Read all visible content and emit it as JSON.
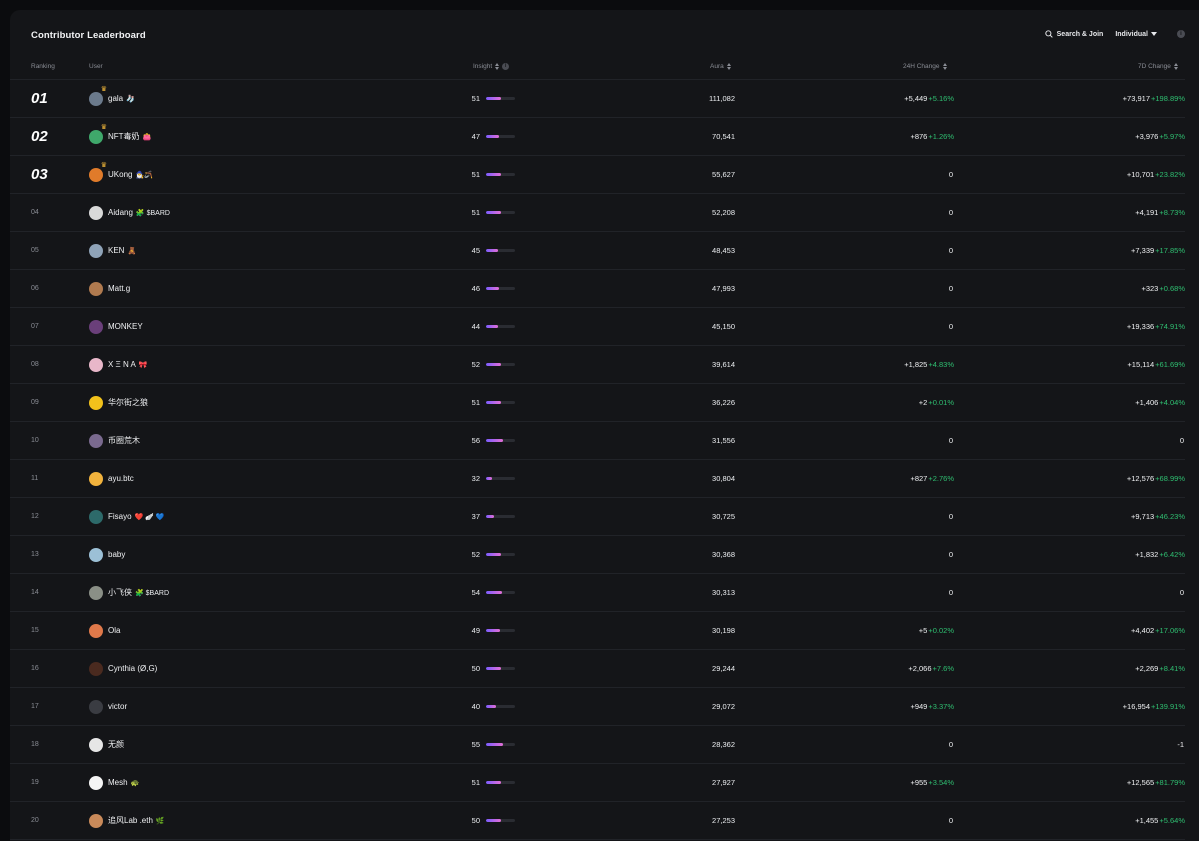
{
  "header": {
    "title": "Contributor Leaderboard",
    "search_join": "Search & Join",
    "filter_selected": "Individual",
    "info_icon": "info-icon"
  },
  "columns": {
    "ranking": "Ranking",
    "user": "User",
    "insight": "Insight",
    "aura": "Aura",
    "change_24h": "24H Change",
    "change_7d": "7D Change"
  },
  "colors": {
    "background": "#141518",
    "positive": "#2fbf71",
    "bar_start": "#7b5cff",
    "bar_end": "#e36fd6"
  },
  "rows": [
    {
      "rank": "01",
      "name": "gala",
      "emoji": "🧦",
      "insight": "51",
      "aura": "111,082",
      "d24": "+5,449",
      "p24": "+5.16%",
      "d7": "+73,917",
      "p7": "+198.89%",
      "avatar": "#6b7a8c",
      "crown": true
    },
    {
      "rank": "02",
      "name": "NFT毒奶",
      "emoji": "👛",
      "insight": "47",
      "aura": "70,541",
      "d24": "+876",
      "p24": "+1.26%",
      "d7": "+3,976",
      "p7": "+5.97%",
      "avatar": "#3fa86b",
      "crown": true
    },
    {
      "rank": "03",
      "name": "UKong",
      "emoji": "🧙‍♂️🪃",
      "insight": "51",
      "aura": "55,627",
      "d24": "0",
      "p24": "",
      "d7": "+10,701",
      "p7": "+23.82%",
      "avatar": "#e07b2a",
      "crown": true
    },
    {
      "rank": "04",
      "name": "Aidang",
      "emoji": "🧩 $BARD",
      "insight": "51",
      "aura": "52,208",
      "d24": "0",
      "p24": "",
      "d7": "+4,191",
      "p7": "+8.73%",
      "avatar": "#d9d9d9",
      "crown": false
    },
    {
      "rank": "05",
      "name": "KEN",
      "emoji": "🧸",
      "insight": "45",
      "aura": "48,453",
      "d24": "0",
      "p24": "",
      "d7": "+7,339",
      "p7": "+17.85%",
      "avatar": "#8fa3b8",
      "crown": false
    },
    {
      "rank": "06",
      "name": "Matt.g",
      "emoji": "",
      "insight": "46",
      "aura": "47,993",
      "d24": "0",
      "p24": "",
      "d7": "+323",
      "p7": "+0.68%",
      "avatar": "#b07a4f",
      "crown": false
    },
    {
      "rank": "07",
      "name": "MONKEY",
      "emoji": "",
      "insight": "44",
      "aura": "45,150",
      "d24": "0",
      "p24": "",
      "d7": "+19,336",
      "p7": "+74.91%",
      "avatar": "#6a3f7a",
      "crown": false
    },
    {
      "rank": "08",
      "name": "X Ξ N A",
      "emoji": "🎀",
      "insight": "52",
      "aura": "39,614",
      "d24": "+1,825",
      "p24": "+4.83%",
      "d7": "+15,114",
      "p7": "+61.69%",
      "avatar": "#e8b7c9",
      "crown": false
    },
    {
      "rank": "09",
      "name": "华尔街之狼",
      "emoji": "",
      "insight": "51",
      "aura": "36,226",
      "d24": "+2",
      "p24": "+0.01%",
      "d7": "+1,406",
      "p7": "+4.04%",
      "avatar": "#f2c21b",
      "crown": false
    },
    {
      "rank": "10",
      "name": "币圈荒木",
      "emoji": "",
      "insight": "56",
      "aura": "31,556",
      "d24": "0",
      "p24": "",
      "d7": "0",
      "p7": "",
      "avatar": "#7a6a8f",
      "crown": false
    },
    {
      "rank": "11",
      "name": "ayu.btc",
      "emoji": "",
      "insight": "32",
      "aura": "30,804",
      "d24": "+827",
      "p24": "+2.76%",
      "d7": "+12,576",
      "p7": "+68.99%",
      "avatar": "#f2b33d",
      "crown": false
    },
    {
      "rank": "12",
      "name": "Fisayo",
      "emoji": "❤️ 🪽 💙",
      "insight": "37",
      "aura": "30,725",
      "d24": "0",
      "p24": "",
      "d7": "+9,713",
      "p7": "+46.23%",
      "avatar": "#2d6a6a",
      "crown": false
    },
    {
      "rank": "13",
      "name": "baby",
      "emoji": "",
      "insight": "52",
      "aura": "30,368",
      "d24": "0",
      "p24": "",
      "d7": "+1,832",
      "p7": "+6.42%",
      "avatar": "#9cc0d6",
      "crown": false
    },
    {
      "rank": "14",
      "name": "小飞侠",
      "emoji": "🧩 $BARD",
      "insight": "54",
      "aura": "30,313",
      "d24": "0",
      "p24": "",
      "d7": "0",
      "p7": "",
      "avatar": "#8a8f86",
      "crown": false
    },
    {
      "rank": "15",
      "name": "Ola",
      "emoji": "",
      "insight": "49",
      "aura": "30,198",
      "d24": "+5",
      "p24": "+0.02%",
      "d7": "+4,402",
      "p7": "+17.06%",
      "avatar": "#e0794a",
      "crown": false
    },
    {
      "rank": "16",
      "name": "Cynthia (Ø,G)",
      "emoji": "",
      "insight": "50",
      "aura": "29,244",
      "d24": "+2,066",
      "p24": "+7.6%",
      "d7": "+2,269",
      "p7": "+8.41%",
      "avatar": "#4a2a1f",
      "crown": false
    },
    {
      "rank": "17",
      "name": "victor",
      "emoji": "",
      "insight": "40",
      "aura": "29,072",
      "d24": "+949",
      "p24": "+3.37%",
      "d7": "+16,954",
      "p7": "+139.91%",
      "avatar": "#3a3c42",
      "crown": false
    },
    {
      "rank": "18",
      "name": "无颜",
      "emoji": "",
      "insight": "55",
      "aura": "28,362",
      "d24": "0",
      "p24": "",
      "d7": "-1",
      "p7": "",
      "avatar": "#e6e6e6",
      "crown": false
    },
    {
      "rank": "19",
      "name": "Mesh",
      "emoji": "🐢",
      "insight": "51",
      "aura": "27,927",
      "d24": "+955",
      "p24": "+3.54%",
      "d7": "+12,565",
      "p7": "+81.79%",
      "avatar": "#f5f5f5",
      "crown": false
    },
    {
      "rank": "20",
      "name": "追风Lab .eth",
      "emoji": "🌿",
      "insight": "50",
      "aura": "27,253",
      "d24": "0",
      "p24": "",
      "d7": "+1,455",
      "p7": "+5.64%",
      "avatar": "#c98a5a",
      "crown": false
    }
  ]
}
